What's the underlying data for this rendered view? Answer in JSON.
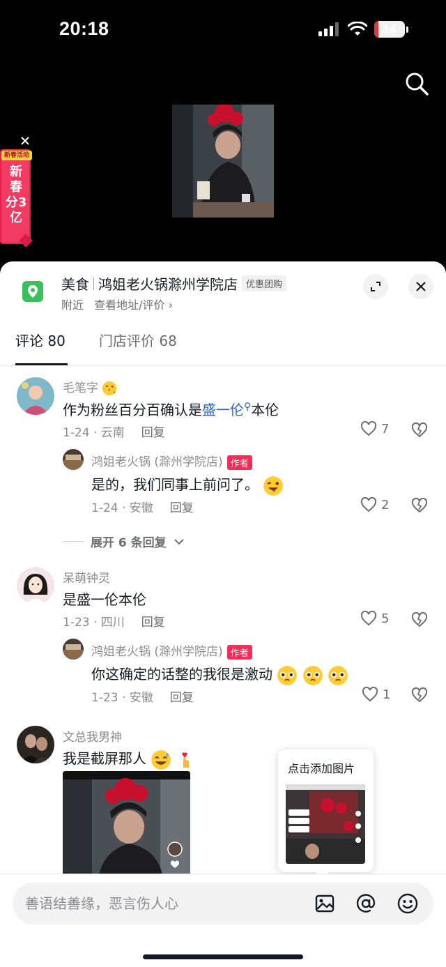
{
  "status_bar": {
    "time": "20:18",
    "battery": "14",
    "battery_level": 0.14
  },
  "promo": {
    "tag": "新春活动",
    "text": "新春分3亿"
  },
  "store": {
    "category": "美食",
    "name": "鸿姐老火锅滁州学院店",
    "badge": "优惠团购",
    "nearby": "附近",
    "address_link": "查看地址/评价 ›"
  },
  "tabs": [
    {
      "label": "评论 80"
    },
    {
      "label": "门店评价 68"
    }
  ],
  "comments": [
    {
      "user": "毛笔字",
      "text_before": "作为粉丝百分百确认是",
      "text_link": "盛一伦",
      "text_after": "本伦",
      "date_loc": "1-24 · 云南",
      "reply": "回复",
      "likes": "7",
      "replies": [
        {
          "user": "鸿姐老火锅 (滁州学院店)",
          "badge": "作者",
          "text": "是的，我们同事上前问了。",
          "date_loc": "1-24 · 安徽",
          "reply": "回复",
          "likes": "2"
        }
      ],
      "expand": "展开 6 条回复"
    },
    {
      "user": "呆萌钟灵",
      "text": "是盛一伦本伦",
      "date_loc": "1-23 · 四川",
      "reply": "回复",
      "likes": "5",
      "replies": [
        {
          "user": "鸿姐老火锅 (滁州学院店)",
          "badge": "作者",
          "text": "你这确定的话整的我很是激动",
          "date_loc": "1-23 · 安徽",
          "reply": "回复",
          "likes": "1"
        }
      ]
    },
    {
      "user": "文总我男神",
      "text": "我是截屏那人"
    }
  ],
  "popup": {
    "title": "点击添加图片"
  },
  "input": {
    "placeholder": "善语结善缘，恶言伤人心"
  },
  "colors": {
    "accent": "#fe2c55",
    "link": "#2864c8",
    "location_green": "#3bbf5c"
  },
  "icons": [
    "search-icon",
    "close-icon",
    "expand-icon",
    "location-icon",
    "heart-icon",
    "broken-heart-icon",
    "image-icon",
    "at-icon",
    "emoji-icon"
  ]
}
